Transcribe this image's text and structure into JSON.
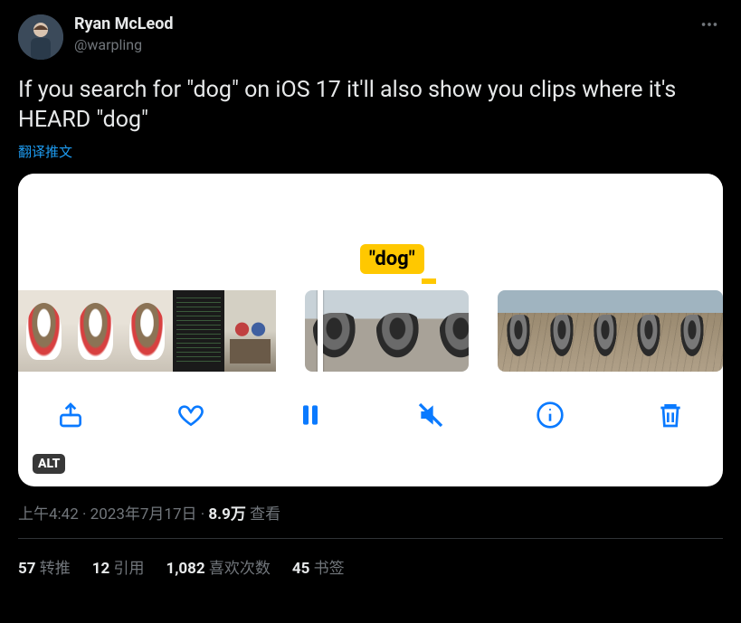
{
  "author": {
    "display_name": "Ryan McLeod",
    "handle": "@warpling"
  },
  "tweet_text": "If you search for \"dog\" on iOS 17 it'll also show you clips where it's HEARD \"dog\"",
  "translate_label": "翻译推文",
  "media": {
    "highlight_tag": "\"dog\"",
    "alt_badge": "ALT"
  },
  "meta": {
    "time": "上午4:42",
    "sep1": " · ",
    "date": "2023年7月17日",
    "sep2": " · ",
    "views_count": "8.9万",
    "views_label": " 查看"
  },
  "stats": {
    "retweets_count": "57",
    "retweets_label": " 转推",
    "quotes_count": "12",
    "quotes_label": " 引用",
    "likes_count": "1,082",
    "likes_label": " 喜欢次数",
    "bookmarks_count": "45",
    "bookmarks_label": " 书签"
  }
}
